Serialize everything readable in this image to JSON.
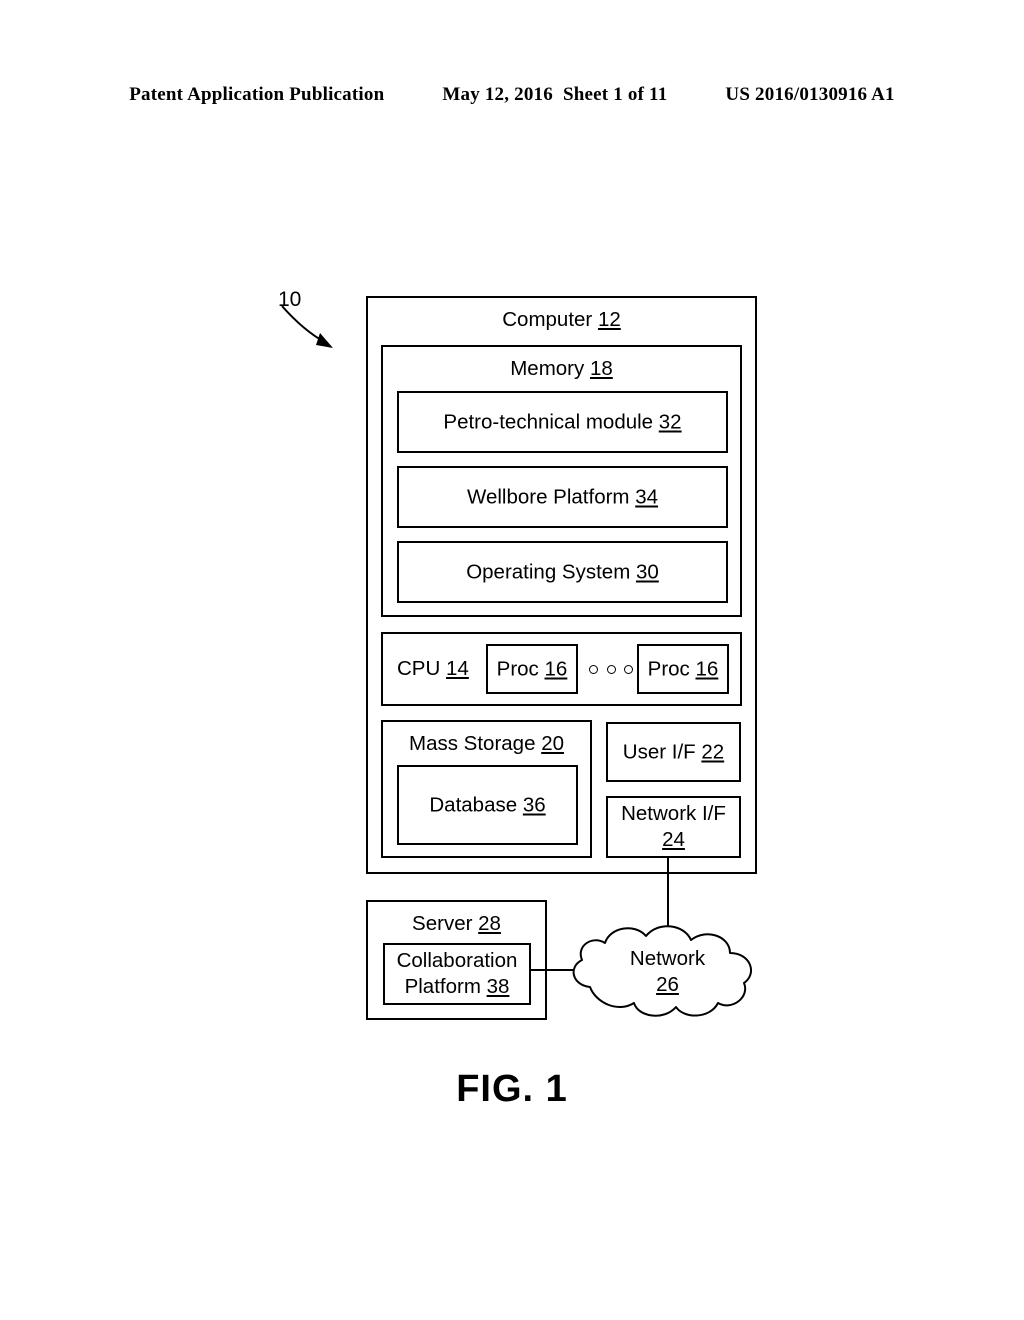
{
  "header": {
    "publication": "Patent Application Publication",
    "date": "May 12, 2016",
    "sheet": "Sheet 1 of 11",
    "patent_number": "US 2016/0130916 A1"
  },
  "figure": {
    "caption": "FIG. 1",
    "system_reference": "10"
  },
  "diagram": {
    "computer": {
      "label_text": "Computer",
      "label_ref": "12"
    },
    "memory": {
      "label_text": "Memory",
      "label_ref": "18",
      "modules": [
        {
          "label_text": "Petro-technical module",
          "label_ref": "32"
        },
        {
          "label_text": "Wellbore Platform",
          "label_ref": "34"
        },
        {
          "label_text": "Operating System",
          "label_ref": "30"
        }
      ]
    },
    "cpu": {
      "label_text": "CPU",
      "label_ref": "14",
      "processors": [
        {
          "label_text": "Proc",
          "label_ref": "16"
        },
        {
          "label_text": "Proc",
          "label_ref": "16"
        }
      ],
      "ellipsis_icon": "three-circles-icon"
    },
    "mass_storage": {
      "label_text": "Mass Storage",
      "label_ref": "20",
      "database": {
        "label_text": "Database",
        "label_ref": "36"
      }
    },
    "user_interface": {
      "label_text": "User I/F",
      "label_ref": "22"
    },
    "network_interface": {
      "label_text": "Network I/F",
      "label_ref": "24"
    },
    "server": {
      "label_text": "Server",
      "label_ref": "28",
      "collaboration_platform": {
        "label_text": "Collaboration Platform",
        "label_ref": "38"
      }
    },
    "network_cloud": {
      "label_text": "Network",
      "label_ref": "26",
      "shape": "cloud-icon"
    }
  },
  "colors": {
    "ink": "#000000",
    "paper": "#ffffff"
  }
}
